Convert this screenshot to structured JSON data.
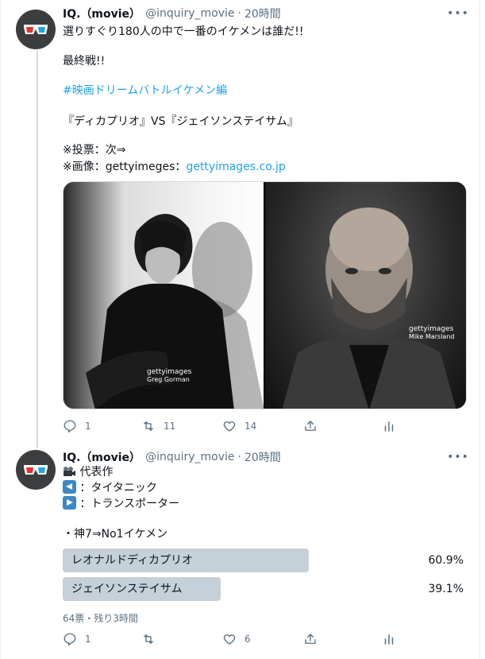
{
  "tweets": [
    {
      "author_name": "IQ.（movie）",
      "handle": "@inquiry_movie",
      "separator": "·",
      "time": "20時間",
      "more": "•••",
      "lines": {
        "l1": "選りすぐり180人の中で一番のイケメンは誰だ!!",
        "l2": "最終戦!!",
        "l3_hashtag": "#映画ドリームバトルイケメン編",
        "l4": "『ディカプリオ』VS『ジェイソンステイサム』",
        "l5": "※投票：次⇒",
        "l6_prefix": "※画像：gettyimeges：",
        "l6_link": "gettyimages.co.jp"
      },
      "media": {
        "left_watermark": "gettyimages",
        "left_credit": "Greg Gorman",
        "right_watermark": "gettyimages",
        "right_credit": "Mike Marsland"
      },
      "actions": {
        "reply_count": "1",
        "retweet_count": "11",
        "like_count": "14"
      }
    },
    {
      "author_name": "IQ.（movie）",
      "handle": "@inquiry_movie",
      "separator": "·",
      "time": "20時間",
      "more": "•••",
      "lines": {
        "l1": "代表作",
        "l2": "：タイタニック",
        "l3": "：トランスポーター",
        "l4": "・神7⇒No1イケメン"
      },
      "poll": {
        "options": [
          {
            "label": "レオナルドディカプリオ",
            "percent_text": "60.9%",
            "percent": 60.9
          },
          {
            "label": "ジェイソンステイサム",
            "percent_text": "39.1%",
            "percent": 39.1
          }
        ],
        "meta": "64票・残り3時間",
        "bar_color": "#c5d0d9"
      },
      "actions": {
        "reply_count": "1",
        "retweet_count": "",
        "like_count": "6"
      }
    }
  ],
  "colors": {
    "link": "#1da1f2",
    "secondary_text": "#5b7083",
    "border": "#cfd9de"
  }
}
